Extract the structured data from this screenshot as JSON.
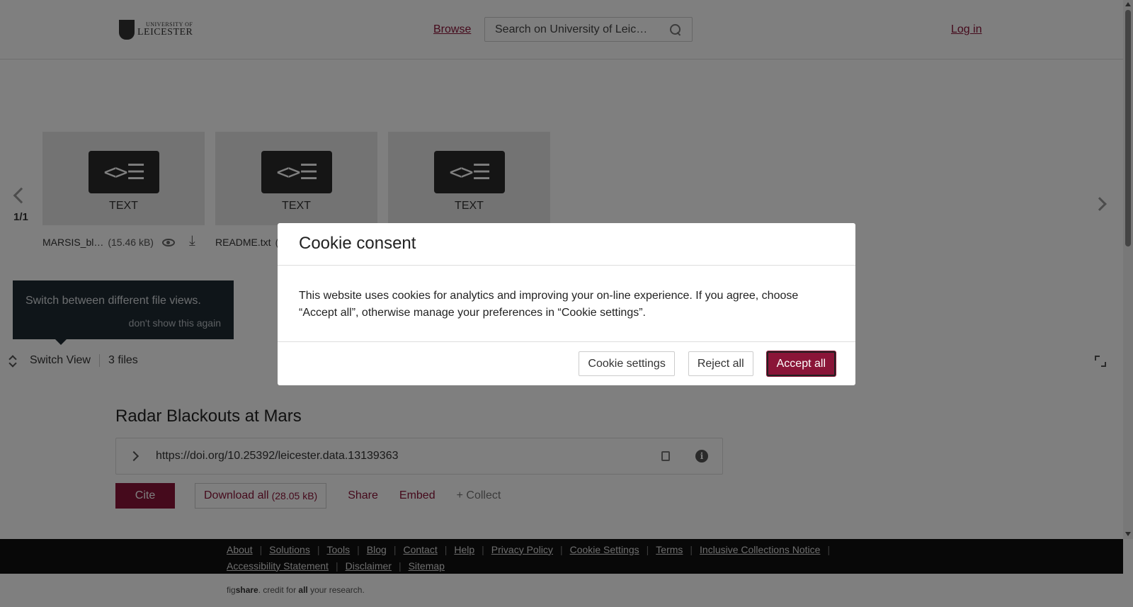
{
  "header": {
    "logo_small": "UNIVERSITY OF",
    "logo_big": "LEICESTER",
    "browse": "Browse",
    "search_placeholder": "Search on University of Leic…",
    "login": "Log in"
  },
  "viewer": {
    "pager": "1/1",
    "files": [
      {
        "type": "TEXT",
        "name": "MARSIS_bl…",
        "size": "(15.46 kB)"
      },
      {
        "type": "TEXT",
        "name": "README.txt",
        "size": "("
      },
      {
        "type": "TEXT"
      }
    ],
    "tooltip_text": "Switch between different file views.",
    "tooltip_hide": "don't show this again",
    "switch_view": "Switch View",
    "file_count": "3 files",
    "code_glyph": "<>☰"
  },
  "item": {
    "title": "Radar Blackouts at Mars",
    "doi": "https://doi.org/10.25392/leicester.data.13139363",
    "cite": "Cite",
    "download_all": "Download all",
    "download_size": "(28.05 kB)",
    "share": "Share",
    "embed": "Embed",
    "collect": "+ Collect"
  },
  "footer": {
    "links_row1": [
      "About",
      "Solutions",
      "Tools",
      "Blog",
      "Contact",
      "Help",
      "Privacy Policy",
      "Cookie Settings",
      "Terms",
      "Inclusive Collections Notice"
    ],
    "links_row2": [
      "Accessibility Statement",
      "Disclaimer",
      "Sitemap"
    ],
    "credit_pre": "fig",
    "credit_brand": "share",
    "credit_mid": ". credit for ",
    "credit_all": "all",
    "credit_post": " your research."
  },
  "cookie_modal": {
    "title": "Cookie consent",
    "body": "This website uses cookies for analytics and improving your on-line experience. If you agree, choose “Accept all”, otherwise manage your preferences in “Cookie settings”.",
    "settings": "Cookie settings",
    "reject": "Reject all",
    "accept": "Accept all"
  },
  "colors": {
    "brand": "#8a1538",
    "overlay": "rgba(0,0,0,0.5)"
  }
}
